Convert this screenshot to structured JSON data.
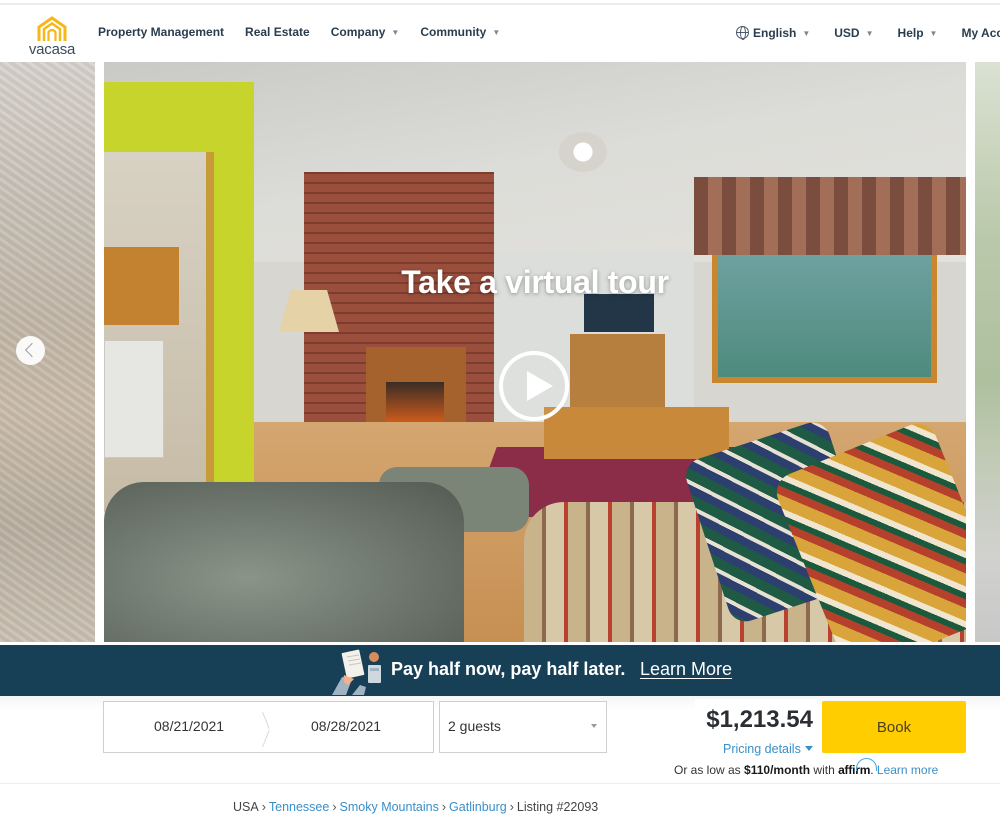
{
  "header": {
    "logo_text": "vacasa",
    "nav": [
      {
        "label": "Property Management",
        "has_dropdown": false
      },
      {
        "label": "Real Estate",
        "has_dropdown": false
      },
      {
        "label": "Company",
        "has_dropdown": true
      },
      {
        "label": "Community",
        "has_dropdown": true
      }
    ],
    "right_nav": {
      "language": "English",
      "currency": "USD",
      "help": "Help",
      "account": "My Acc"
    }
  },
  "gallery": {
    "tour_title": "Take a virtual tour",
    "prev_arrow_icon": "chevron-left-icon",
    "play_icon": "play-icon"
  },
  "banner": {
    "text": "Pay half now, pay half later.",
    "link": "Learn More",
    "background": "#173f55"
  },
  "booking": {
    "check_in": "08/21/2021",
    "check_out": "08/28/2021",
    "guests": "2 guests",
    "price": "$1,213.54",
    "pricing_details": "Pricing details",
    "book_label": "Book",
    "book_color": "#ffcd00",
    "affirm": {
      "prefix": "Or as low as ",
      "amount": "$110/month",
      "with": " with ",
      "brand": "affirm",
      "suffix": ". ",
      "learn_more": "Learn more"
    }
  },
  "breadcrumb": {
    "items": [
      {
        "label": "USA",
        "link": false
      },
      {
        "label": "Tennessee",
        "link": true
      },
      {
        "label": "Smoky Mountains",
        "link": true
      },
      {
        "label": "Gatlinburg",
        "link": true
      },
      {
        "label": "Listing #22093",
        "link": false
      }
    ],
    "separator": "›"
  },
  "colors": {
    "link": "#3b8fc7",
    "accent_yellow": "#ffcd00",
    "brand_dark": "#173f55"
  }
}
